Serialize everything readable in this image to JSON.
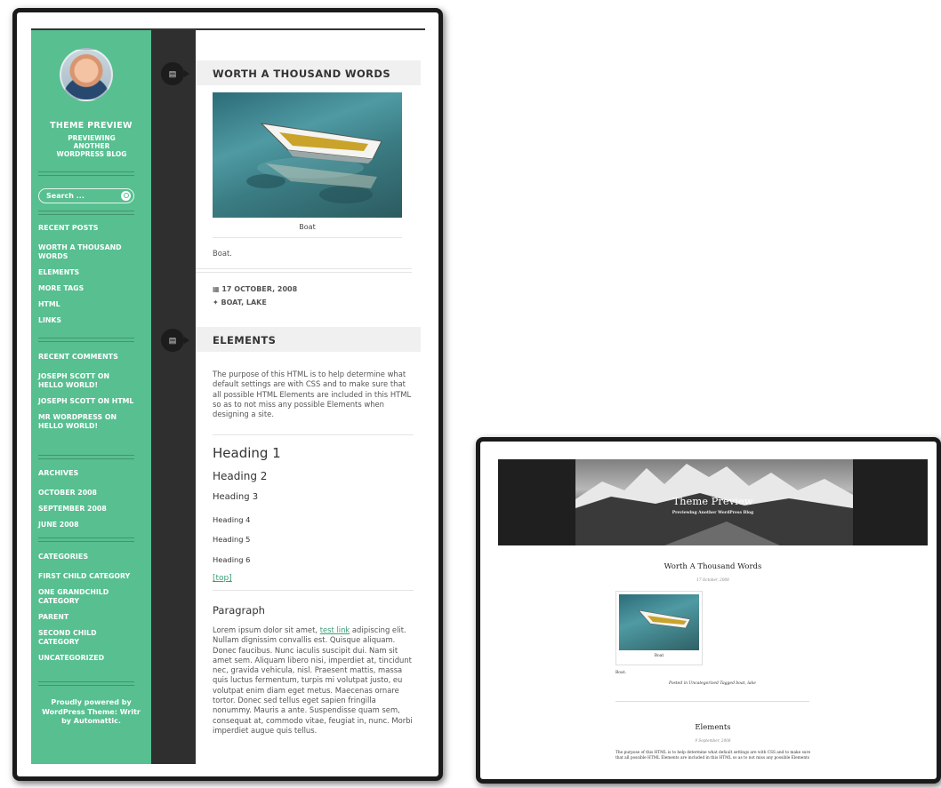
{
  "left": {
    "sidebar": {
      "site_title": "THEME PREVIEW",
      "site_description": "PREVIEWING ANOTHER WORDPRESS BLOG",
      "search_placeholder": "Search ...",
      "widgets": [
        {
          "title": "RECENT POSTS",
          "items": [
            "WORTH A THOUSAND WORDS",
            "ELEMENTS",
            "MORE TAGS",
            "HTML",
            "LINKS"
          ]
        },
        {
          "title": "RECENT COMMENTS",
          "items": [
            "JOSEPH SCOTT ON HELLO WORLD!",
            "JOSEPH SCOTT ON HTML",
            "MR WORDPRESS ON HELLO WORLD!"
          ]
        },
        {
          "title": "ARCHIVES",
          "items": [
            "OCTOBER 2008",
            "SEPTEMBER 2008",
            "JUNE 2008"
          ]
        },
        {
          "title": "CATEGORIES",
          "items": [
            "FIRST CHILD CATEGORY",
            "ONE GRANDCHILD CATEGORY",
            "PARENT",
            "SECOND CHILD CATEGORY",
            "UNCATEGORIZED"
          ]
        }
      ],
      "footer": "Proudly powered by WordPress Theme: Writr by Automattic."
    },
    "posts": [
      {
        "title": "WORTH A THOUSAND WORDS",
        "caption": "Boat",
        "excerpt": "Boat.",
        "date": "17 OCTOBER, 2008",
        "tags": "BOAT, LAKE"
      },
      {
        "title": "ELEMENTS",
        "intro": "The purpose of this HTML is to help determine what default settings are with CSS and to make sure that all possible HTML Elements are included in this HTML so as to not miss any possible Elements when designing a site.",
        "headings": [
          "Heading 1",
          "Heading 2",
          "Heading 3",
          "Heading 4",
          "Heading 5",
          "Heading 6"
        ],
        "top_link": "[top]",
        "paragraph_heading": "Paragraph",
        "paragraph_start": "Lorem ipsum dolor sit amet, ",
        "paragraph_link": "test link",
        "paragraph_rest": " adipiscing elit. Nullam dignissim convallis est. Quisque aliquam. Donec faucibus. Nunc iaculis suscipit dui. Nam sit amet sem. Aliquam libero nisi, imperdiet at, tincidunt nec, gravida vehicula, nisl. Praesent mattis, massa quis luctus fermentum, turpis mi volutpat justo, eu volutpat enim diam eget metus. Maecenas ornare tortor. Donec sed tellus eget sapien fringilla nonummy. Mauris a ante. Suspendisse quam sem, consequat at, commodo vitae, feugiat in, nunc. Morbi imperdiet augue quis tellus."
      }
    ]
  },
  "right": {
    "header_title": "Theme Preview",
    "header_tagline": "Previewing Another WordPress Blog",
    "post1_title": "Worth A Thousand Words",
    "post1_date": "17 October, 2008",
    "post1_caption": "Boat",
    "post1_excerpt": "Boat.",
    "post1_meta_posted": "Posted in",
    "post1_meta_category": "Uncategorized",
    "post1_meta_tagged": "Tagged",
    "post1_meta_tags": "boat, lake",
    "post2_title": "Elements",
    "post2_date": "9 September, 2008",
    "post2_body": "The purpose of this HTML is to help determine what default settings are with CSS and to make sure that all possible HTML Elements are included in this HTML so as to not miss any possible Elements"
  }
}
